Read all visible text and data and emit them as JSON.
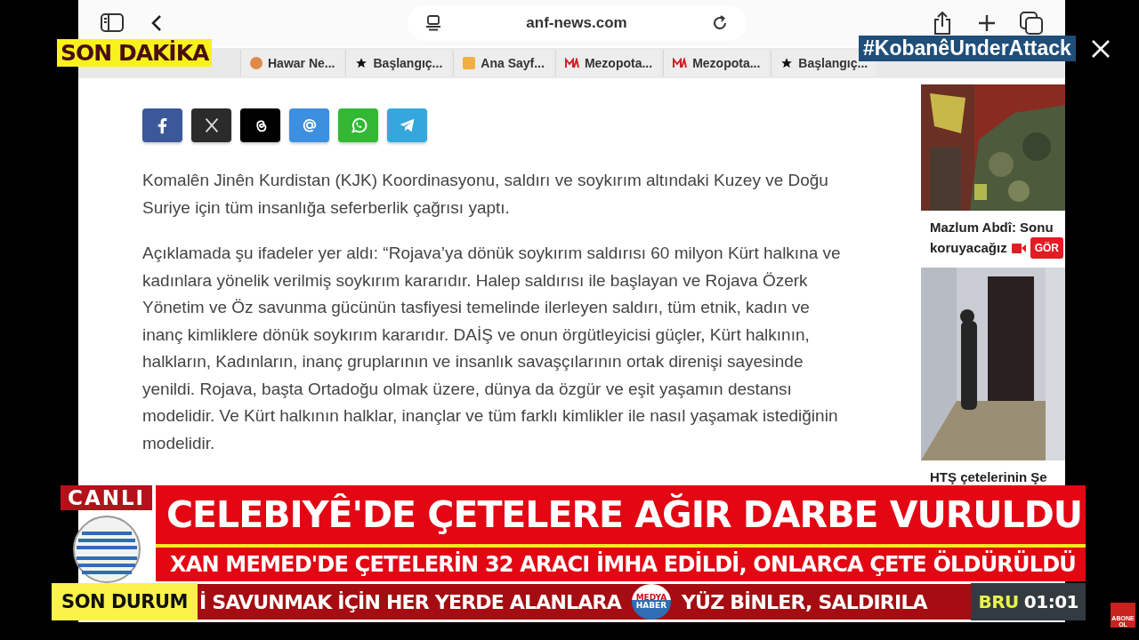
{
  "browser": {
    "url": "anf-news.com",
    "bookmarks": [
      {
        "kind": "letter",
        "label": "Hawar Ne..."
      },
      {
        "kind": "star",
        "label": "Başlangıç..."
      },
      {
        "kind": "square",
        "label": "Ana Sayf..."
      },
      {
        "kind": "logo",
        "label": "Mezopota..."
      },
      {
        "kind": "logo",
        "label": "Mezopota..."
      },
      {
        "kind": "star",
        "label": "Başlangıç..."
      }
    ]
  },
  "share_buttons": [
    {
      "kind": "facebook"
    },
    {
      "kind": "x"
    },
    {
      "kind": "threads"
    },
    {
      "kind": "email"
    },
    {
      "kind": "whatsapp"
    },
    {
      "kind": "telegram"
    }
  ],
  "article": {
    "paragraphs": [
      "Komalên Jinên Kurdistan (KJK) Koordinasyonu, saldırı ve soykırım altındaki Kuzey ve Doğu Suriye için tüm insanlığa seferberlik çağrısı yaptı.",
      "Açıklamada şu ifadeler yer aldı:  “Rojava’ya dönük soykırım saldırısı 60 milyon Kürt halkına ve kadınlara yönelik verilmiş soykırım kararıdır. Halep saldırısı ile başlayan ve Rojava Özerk Yönetim ve Öz savunma gücünün tasfiyesi temelinde ilerleyen saldırı, tüm etnik, kadın ve inanç kimliklere dönük soykırım kararıdır. DAİŞ ve onun örgütleyicisi güçler, Kürt halkının, halkların, Kadınların, inanç gruplarının ve insanlık savaşçılarının ortak direnişi sayesinde yenildi. Rojava, başta Ortadoğu olmak üzere, dünya da özgür ve eşit yaşamın destansı modelidir. Ve Kürt halkının halklar, inançlar ve tüm farklı kimlikler ile nasıl yaşamak istediğinin modelidir."
    ]
  },
  "sidebar": {
    "items": [
      {
        "kind": "picture",
        "lines": [
          "Mazlum Abdî: Sonu",
          "koruyacağız"
        ],
        "video": true,
        "badge": "GÖR"
      },
      {
        "kind": "picture",
        "lines": [
          "HTŞ çetelerinin Şe"
        ],
        "video": false
      }
    ]
  },
  "overlay": {
    "breaking_label": "SON DAKİKA",
    "hashtag": "#KobanêUnderAttack",
    "live": "CANLI",
    "headline": "CELEBIYÊ'DE ÇETELERE AĞIR DARBE VURULDU",
    "subheadline": "XAN MEMED'DE ÇETELERİN 32 ARACI İMHA EDİLDİ, ONLARCA ÇETE ÖLDÜRÜLDÜ",
    "ticker_label": "SON DURUM",
    "ticker": [
      "İ SAVUNMAK İÇİN HER YERDE ALANLARA",
      "YÜZ BİNLER, SALDIRILA"
    ],
    "ticker_logo": [
      "MEDYA",
      "HABER"
    ],
    "clock_city": "BRU",
    "clock_time": "01:01",
    "subscribe": [
      "ABONE",
      "OL"
    ]
  }
}
